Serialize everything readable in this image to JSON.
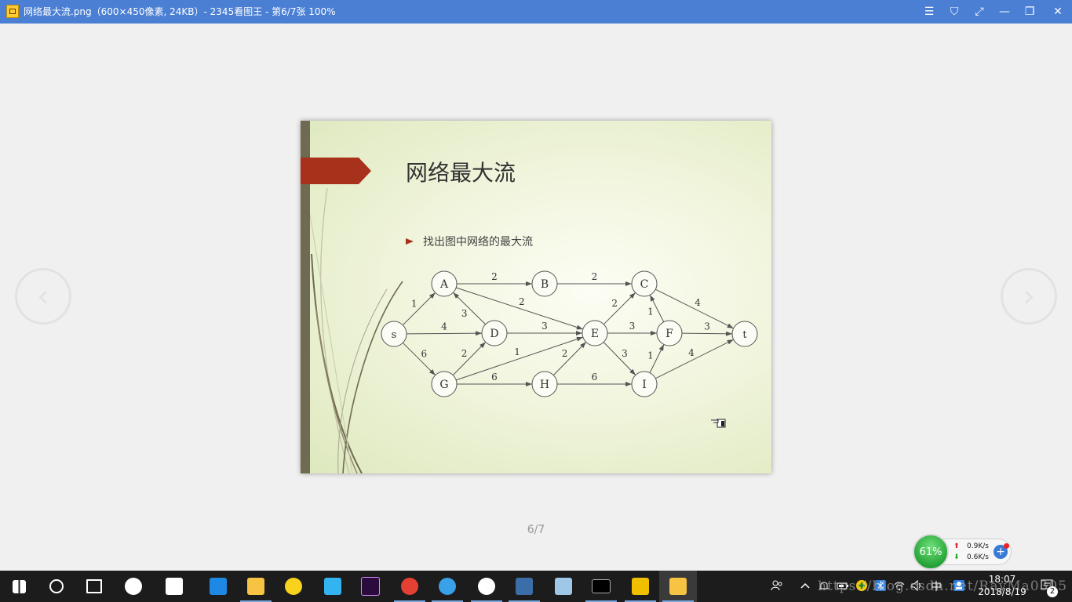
{
  "window": {
    "title": "网络最大流.png（600×450像素, 24KB）- 2345看图王 - 第6/7张 100%",
    "buttons": [
      "menu",
      "skin",
      "fullscreen",
      "minimize",
      "restore",
      "close"
    ]
  },
  "slide": {
    "title": "网络最大流",
    "bullet": "找出图中网络的最大流",
    "accent_color": "#a8311c",
    "bar_color": "#6f6a52"
  },
  "graph": {
    "nodes": [
      "s",
      "A",
      "B",
      "C",
      "D",
      "E",
      "F",
      "G",
      "H",
      "I",
      "t"
    ],
    "edges": [
      {
        "from": "s",
        "to": "A",
        "label": "1"
      },
      {
        "from": "s",
        "to": "D",
        "label": "4"
      },
      {
        "from": "s",
        "to": "G",
        "label": "6"
      },
      {
        "from": "A",
        "to": "B",
        "label": "2"
      },
      {
        "from": "A",
        "to": "E",
        "label": "2"
      },
      {
        "from": "D",
        "to": "A",
        "label": "3"
      },
      {
        "from": "D",
        "to": "E",
        "label": "3"
      },
      {
        "from": "G",
        "to": "D",
        "label": "2"
      },
      {
        "from": "G",
        "to": "E",
        "label": "1"
      },
      {
        "from": "G",
        "to": "H",
        "label": "6"
      },
      {
        "from": "H",
        "to": "E",
        "label": "2"
      },
      {
        "from": "H",
        "to": "I",
        "label": "6"
      },
      {
        "from": "B",
        "to": "C",
        "label": "2"
      },
      {
        "from": "E",
        "to": "C",
        "label": "2"
      },
      {
        "from": "E",
        "to": "F",
        "label": "3"
      },
      {
        "from": "E",
        "to": "I",
        "label": "3"
      },
      {
        "from": "F",
        "to": "C",
        "label": "1"
      },
      {
        "from": "I",
        "to": "F",
        "label": "1"
      },
      {
        "from": "C",
        "to": "t",
        "label": "4"
      },
      {
        "from": "F",
        "to": "t",
        "label": "3"
      },
      {
        "from": "I",
        "to": "t",
        "label": "4"
      }
    ]
  },
  "viewer": {
    "page_indicator": "6/7",
    "prev_glyph": "‹",
    "next_glyph": "›"
  },
  "net_widget": {
    "percent": "61%",
    "upload": "0.9K/s",
    "download": "0.6K/s"
  },
  "taskbar": {
    "apps": [
      "start-icon",
      "cortana-icon",
      "task-view-icon",
      "pinwheel-icon",
      "ie-icon",
      "edge-icon",
      "file-explorer-icon",
      "qq-music-icon",
      "video-player-icon",
      "premiere-icon",
      "chrome-icon",
      "browser-e-icon",
      "wechat-icon",
      "sql-tool-icon",
      "notes-icon",
      "cmd-icon",
      "tools-icon",
      "image-viewer-icon"
    ],
    "ime": "中",
    "time": "18:07",
    "date": "2018/8/19",
    "notification_count": "2",
    "watermark": "https://blog.csdn.net/RayMa0305"
  }
}
